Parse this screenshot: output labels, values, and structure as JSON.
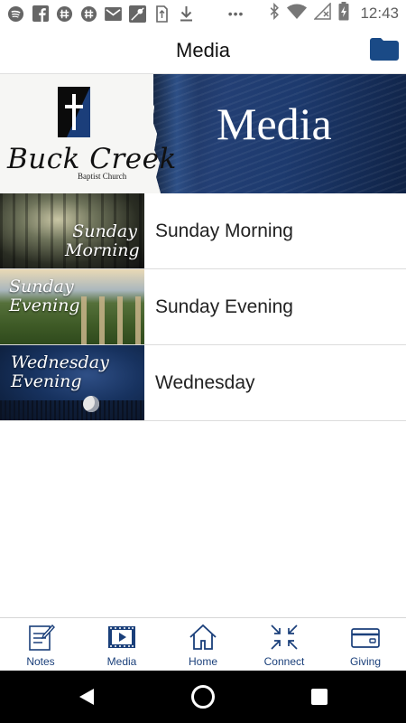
{
  "status_bar": {
    "time": "12:43",
    "left_icons": [
      "spotify-icon",
      "facebook-icon",
      "slack-icon",
      "slack-icon",
      "gmail-icon",
      "maps-icon",
      "sim-icon",
      "download-icon"
    ],
    "overflow": "•••",
    "right_icons": [
      "bluetooth-icon",
      "wifi-icon",
      "no-signal-icon",
      "battery-charging-icon"
    ]
  },
  "header": {
    "title": "Media",
    "folder_icon": "folder-icon"
  },
  "banner": {
    "brand_name": "Buck Creek",
    "brand_sub": "Baptist Church",
    "title": "Media"
  },
  "media_items": [
    {
      "thumb_text": "Sunday Morning",
      "label": "Sunday Morning"
    },
    {
      "thumb_text": "Sunday Evening",
      "label": "Sunday Evening"
    },
    {
      "thumb_text": "Wednesday Evening",
      "label": "Wednesday"
    }
  ],
  "thumb_lines": {
    "t1": [
      "Sunday",
      "Morning"
    ],
    "t2": [
      "Sunday",
      "Evening"
    ],
    "t3": [
      "Wednesday",
      "Evening"
    ]
  },
  "bottom_nav": [
    {
      "label": "Notes",
      "icon": "notes-icon"
    },
    {
      "label": "Media",
      "icon": "media-icon"
    },
    {
      "label": "Home",
      "icon": "home-icon"
    },
    {
      "label": "Connect",
      "icon": "connect-icon"
    },
    {
      "label": "Giving",
      "icon": "giving-icon"
    }
  ],
  "colors": {
    "accent": "#1a3f7a",
    "banner_blue": "#233f74"
  }
}
